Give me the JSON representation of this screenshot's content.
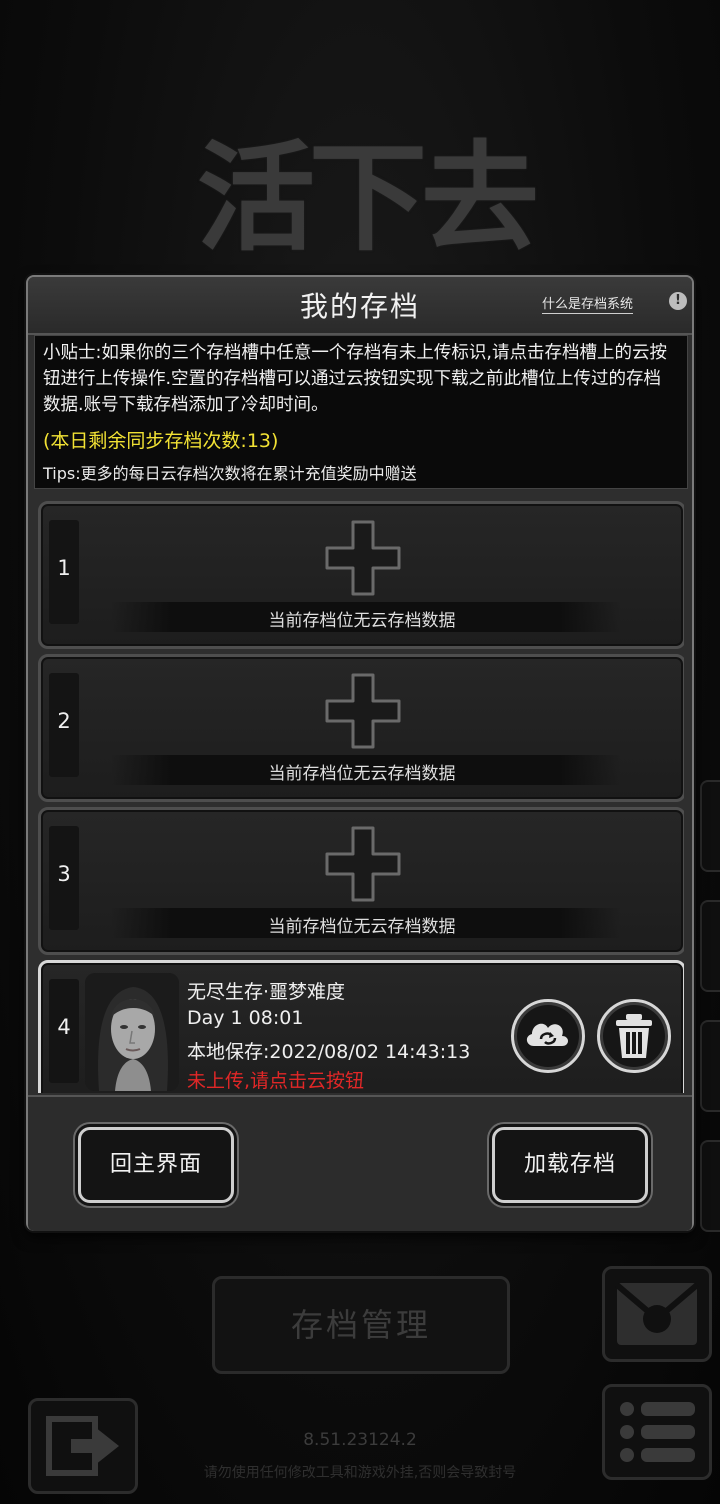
{
  "background": {
    "game_title": "活下去",
    "save_manage_label": "存档管理",
    "version": "8.51.23124.2",
    "warning": "请勿使用任何修改工具和游戏外挂,否则会导致封号"
  },
  "dialog": {
    "title": "我的存档",
    "help_link": "什么是存档系统",
    "help_icon_glyph": "!",
    "tip_text": "小贴士:如果你的三个存档槽中任意一个存档有未上传标识,请点击存档槽上的云按钮进行上传操作.空置的存档槽可以通过云按钮实现下载之前此槽位上传过的存档数据.账号下载存档添加了冷却时间。",
    "sync_count": "(本日剩余同步存档次数:13)",
    "tips_extra": "Tips:更多的每日云存档次数将在累计充值奖励中赠送",
    "slots": [
      {
        "number": "1",
        "status": "当前存档位无云存档数据"
      },
      {
        "number": "2",
        "status": "当前存档位无云存档数据"
      },
      {
        "number": "3",
        "status": "当前存档位无云存档数据"
      }
    ],
    "slot4": {
      "number": "4",
      "mode": "无尽生存·噩梦难度",
      "day": "Day 1  08:01",
      "local_save": "本地保存:2022/08/02  14:43:13",
      "upload_warning": "未上传,请点击云按钮",
      "upload_icon": "cloud-upload-icon",
      "delete_icon": "trash-icon"
    },
    "buttons": {
      "back_home": "回主界面",
      "load_save": "加载存档"
    }
  },
  "colors": {
    "sync_count": "#f2e234",
    "warning_red": "#e12727"
  }
}
